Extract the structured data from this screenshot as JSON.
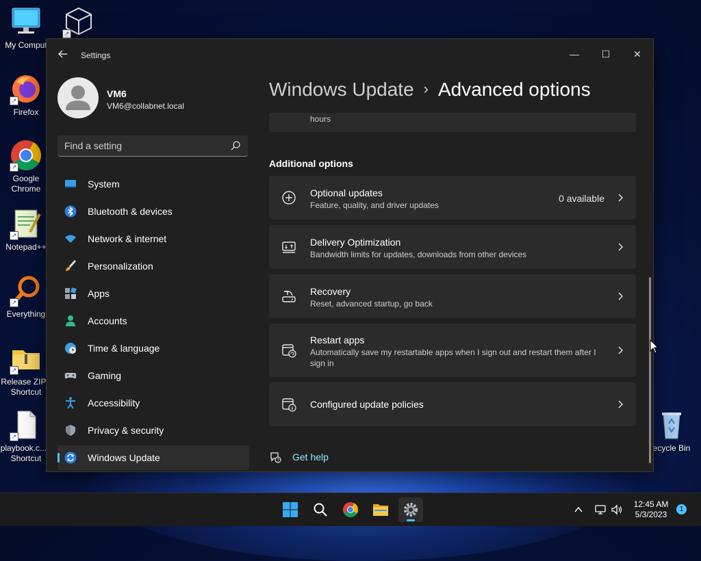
{
  "desktop": {
    "icons": [
      {
        "name": "my-computer",
        "label": "My Comput"
      },
      {
        "name": "firefox",
        "label": "Firefox"
      },
      {
        "name": "google-chrome",
        "label": "Google Chrome"
      },
      {
        "name": "notepad-plus-plus",
        "label": "Notepad++"
      },
      {
        "name": "everything",
        "label": "Everything"
      },
      {
        "name": "release-zip",
        "label": "Release ZIP - Shortcut"
      },
      {
        "name": "playbook",
        "label": "playbook.c... - Shortcut"
      },
      {
        "name": "recycle-bin",
        "label": "ecycle Bin"
      }
    ]
  },
  "window": {
    "app_title": "Settings",
    "controls": {
      "minimize": "—",
      "maximize": "☐",
      "close": "✕"
    }
  },
  "profile": {
    "name": "VM6",
    "email": "VM6@collabnet.local"
  },
  "search": {
    "placeholder": "Find a setting"
  },
  "sidebar": {
    "items": [
      {
        "label": "System",
        "icon": "system-icon"
      },
      {
        "label": "Bluetooth & devices",
        "icon": "bluetooth-icon"
      },
      {
        "label": "Network & internet",
        "icon": "wifi-icon"
      },
      {
        "label": "Personalization",
        "icon": "brush-icon"
      },
      {
        "label": "Apps",
        "icon": "apps-icon"
      },
      {
        "label": "Accounts",
        "icon": "person-icon"
      },
      {
        "label": "Time & language",
        "icon": "clock-globe-icon"
      },
      {
        "label": "Gaming",
        "icon": "gamepad-icon"
      },
      {
        "label": "Accessibility",
        "icon": "accessibility-icon"
      },
      {
        "label": "Privacy & security",
        "icon": "shield-icon"
      },
      {
        "label": "Windows Update",
        "icon": "sync-icon",
        "active": true
      }
    ]
  },
  "main": {
    "breadcrumb": {
      "parent": "Windows Update",
      "separator": "›",
      "current": "Advanced options"
    },
    "partial_card_text": "hours",
    "section_title": "Additional options",
    "cards": [
      {
        "title": "Optional updates",
        "desc": "Feature, quality, and driver updates",
        "status": "0 available"
      },
      {
        "title": "Delivery Optimization",
        "desc": "Bandwidth limits for updates, downloads from other devices"
      },
      {
        "title": "Recovery",
        "desc": "Reset, advanced startup, go back"
      },
      {
        "title": "Restart apps",
        "desc": "Automatically save my restartable apps when I sign out and restart them after I sign in"
      },
      {
        "title": "Configured update policies"
      }
    ],
    "get_help": "Get help"
  },
  "taskbar": {
    "time": "12:45 AM",
    "date": "5/3/2023",
    "notification_count": "1"
  },
  "colors": {
    "accent": "#4cc2ff",
    "window_bg": "#202020",
    "card_bg": "#2b2b2b",
    "link": "#99ebff"
  }
}
